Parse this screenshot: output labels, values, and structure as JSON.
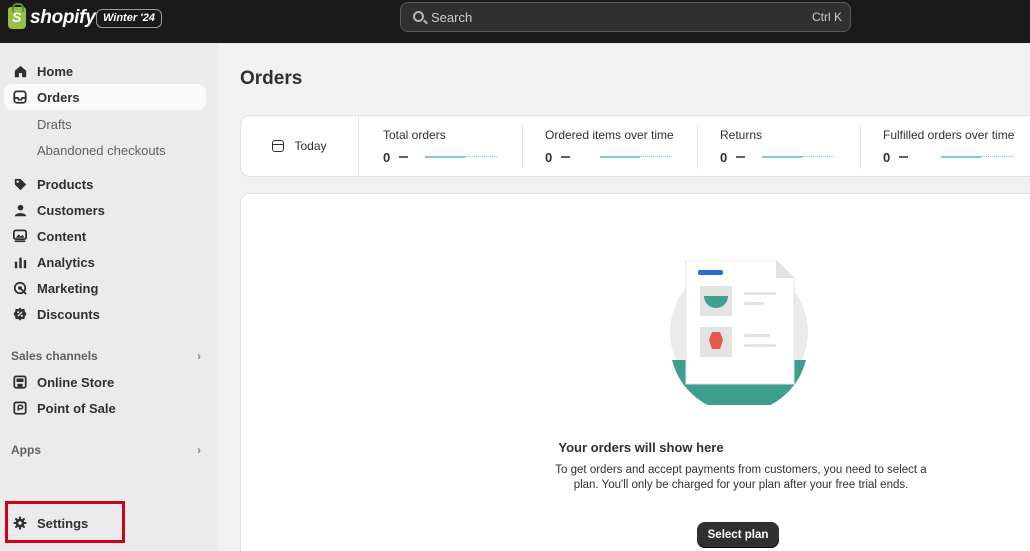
{
  "topbar": {
    "brand": "shopify",
    "edition_badge": "Winter '24",
    "search_placeholder": "Search",
    "search_shortcut": "Ctrl K"
  },
  "sidebar": {
    "items": [
      {
        "label": "Home",
        "icon": "home-icon"
      },
      {
        "label": "Orders",
        "icon": "inbox-icon",
        "active": true
      },
      {
        "label": "Drafts"
      },
      {
        "label": "Abandoned checkouts"
      },
      {
        "label": "Products",
        "icon": "tag-icon"
      },
      {
        "label": "Customers",
        "icon": "person-icon"
      },
      {
        "label": "Content",
        "icon": "image-icon"
      },
      {
        "label": "Analytics",
        "icon": "bar-chart-icon"
      },
      {
        "label": "Marketing",
        "icon": "target-icon"
      },
      {
        "label": "Discounts",
        "icon": "discount-icon"
      }
    ],
    "sales_channels_heading": "Sales channels",
    "channels": [
      {
        "label": "Online Store",
        "icon": "store-icon"
      },
      {
        "label": "Point of Sale",
        "icon": "pos-icon"
      }
    ],
    "apps_heading": "Apps",
    "settings_label": "Settings",
    "highlight_color": "#d0021b"
  },
  "main": {
    "title": "Orders",
    "date_filter": "Today",
    "metrics": [
      {
        "label": "Total orders",
        "value": "0"
      },
      {
        "label": "Ordered items over time",
        "value": "0"
      },
      {
        "label": "Returns",
        "value": "0"
      },
      {
        "label": "Fulfilled orders over time",
        "value": "0"
      }
    ],
    "empty_state": {
      "title": "Your orders will show here",
      "description": "To get orders and accept payments from customers, you need to select a plan. You'll only be charged for your plan after your free trial ends.",
      "button_label": "Select plan"
    }
  },
  "colors": {
    "topbar_bg": "#1a1a1a",
    "accent_teal": "#3f9f8f",
    "sparkline": "#7ec8e3",
    "primary_button": "#303030"
  }
}
